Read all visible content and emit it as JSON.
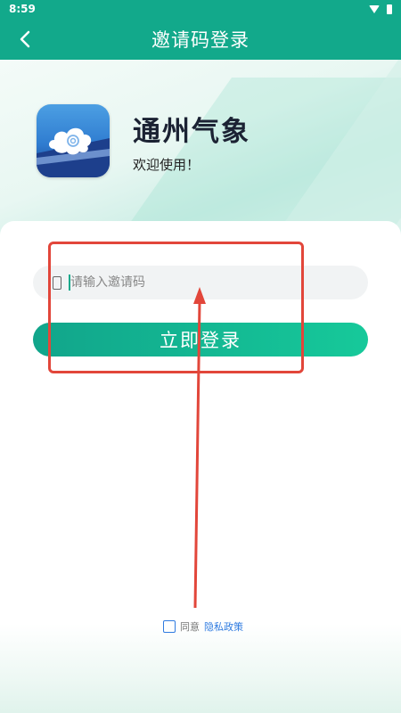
{
  "status_bar": {
    "time": "8:59",
    "wifi_icon": "wifi-icon",
    "battery_icon": "battery-icon"
  },
  "app_bar": {
    "title": "邀请码登录",
    "back_icon": "chevron-left-icon"
  },
  "app": {
    "name": "通州气象",
    "welcome": "欢迎使用！",
    "logo_icon": "cloud-logo-icon"
  },
  "form": {
    "input_placeholder": "请输入邀请码",
    "input_value": "",
    "input_icon": "phone-icon",
    "login_label": "立即登录"
  },
  "privacy": {
    "agree_text": "同意",
    "policy_link": "隐私政策",
    "checked": false
  },
  "colors": {
    "primary": "#12a98b",
    "button_start": "#11a58b",
    "button_end": "#16c99a",
    "link": "#2f7be0",
    "annotation": "#e2463a"
  }
}
